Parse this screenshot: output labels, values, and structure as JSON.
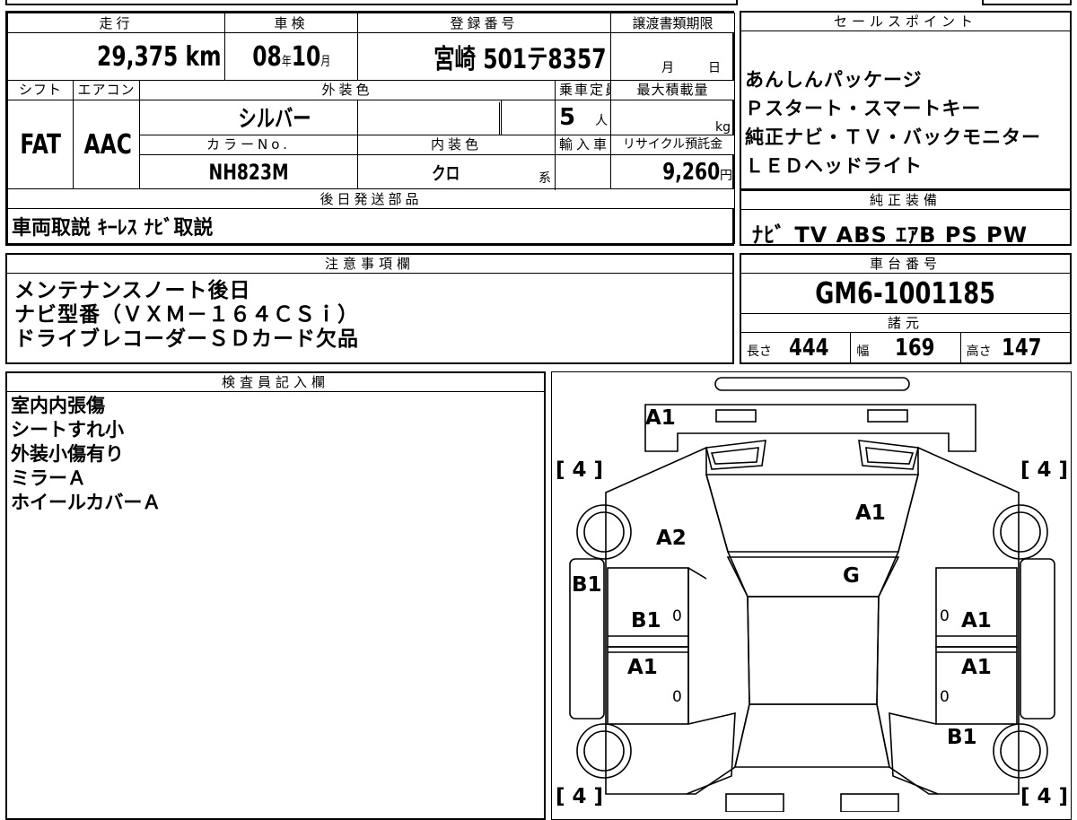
{
  "car": {
    "mileage_label": "走行",
    "mileage": "29,375",
    "mileage_unit": "km",
    "shaken_label": "車検",
    "shaken_year": "08",
    "shaken_year_unit": "年",
    "shaken_month": "10",
    "shaken_month_unit": "月",
    "plate_label": "登録番号",
    "plate": "宮崎 501テ8357",
    "transfer_label": "譲渡書類期限",
    "transfer_month_unit": "月",
    "transfer_day_unit": "日",
    "shift_label": "シフト",
    "shift": "FAT",
    "ac_label": "エアコン",
    "ac": "AAC",
    "exterior_label": "外装色",
    "exterior": "シルバー",
    "capacity_label": "乗車定員",
    "capacity": "5",
    "capacity_unit": "人",
    "maxload_label": "最大積載量",
    "maxload_unit": "kg",
    "colorno_label": "カラーNo.",
    "colorno": "NH823M",
    "interior_label": "内装色",
    "interior": "クロ",
    "interior_unit": "系",
    "import_label": "輸入車",
    "recycle_label": "リサイクル預託金",
    "recycle": "9,260",
    "recycle_unit": "円",
    "later_label": "後日発送部品",
    "later": "車両取説 ｷｰﾚｽ ﾅﾋﾞ取説"
  },
  "sales": {
    "label": "セールスポイント",
    "items": [
      "あんしんパッケージ",
      "Ｐスタート・スマートキー",
      "純正ナビ・ＴＶ・バックモニター",
      "ＬＥＤヘッドライト"
    ]
  },
  "equip": {
    "label": "純正装備",
    "items": "ﾅﾋﾞ TV ABS ｴｱB PS PW"
  },
  "notes": {
    "label": "注意事項欄",
    "lines": [
      "メンテナンスノート後日",
      "ナビ型番（ＶＸＭ－１６４ＣＳｉ）",
      "ドライブレコーダーＳＤカード欠品"
    ]
  },
  "chassis": {
    "label": "車台番号",
    "value": "GM6-1001185"
  },
  "specs": {
    "label": "諸元",
    "length_label": "長さ",
    "length": "444",
    "width_label": "幅",
    "width": "169",
    "height_label": "高さ",
    "height": "147"
  },
  "inspector": {
    "label": "検査員記入欄",
    "lines": [
      "室内内張傷",
      "シートすれ小",
      "外装小傷有り",
      "ミラーＡ",
      "ホイールカバーＡ"
    ]
  },
  "diagram": {
    "tire_fl": "4",
    "tire_fr": "4",
    "tire_rl": "4",
    "tire_rr": "4",
    "front_bumper": "A1",
    "hood": "A1",
    "left_fender": "A2",
    "windshield": "G",
    "left_pillar": "B1",
    "left_front_door": "B1",
    "left_rear_door": "A1",
    "right_front_door": "A1",
    "right_rear_door": "A1",
    "right_rear_fender": "B1",
    "zero": "0"
  }
}
